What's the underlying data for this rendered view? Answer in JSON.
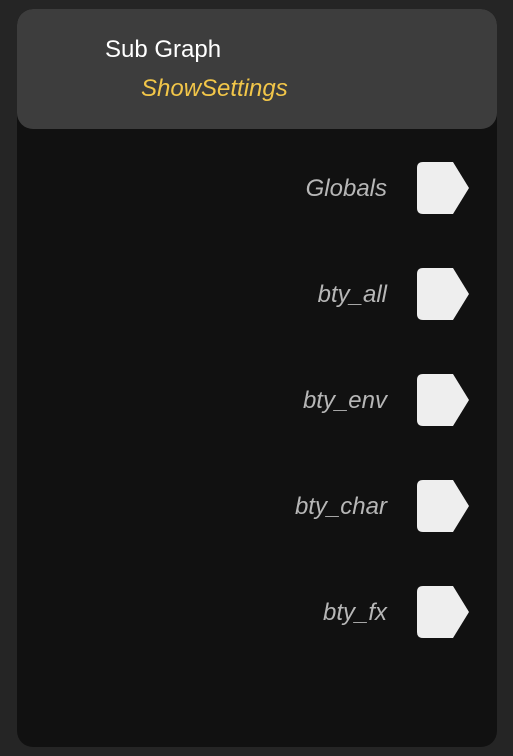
{
  "node": {
    "type_label": "Sub Graph",
    "name": "ShowSettings",
    "ports": [
      {
        "label": "Globals",
        "icon": "output-port-icon"
      },
      {
        "label": "bty_all",
        "icon": "output-port-icon"
      },
      {
        "label": "bty_env",
        "icon": "output-port-icon"
      },
      {
        "label": "bty_char",
        "icon": "output-port-icon"
      },
      {
        "label": "bty_fx",
        "icon": "output-port-icon"
      }
    ]
  },
  "colors": {
    "canvas_background": "#252525",
    "node_body": "#111111",
    "node_header": "#3d3d3d",
    "node_name_accent": "#f2c649",
    "port_label": "#b7b7b7",
    "port_connector": "#eeeeee"
  }
}
